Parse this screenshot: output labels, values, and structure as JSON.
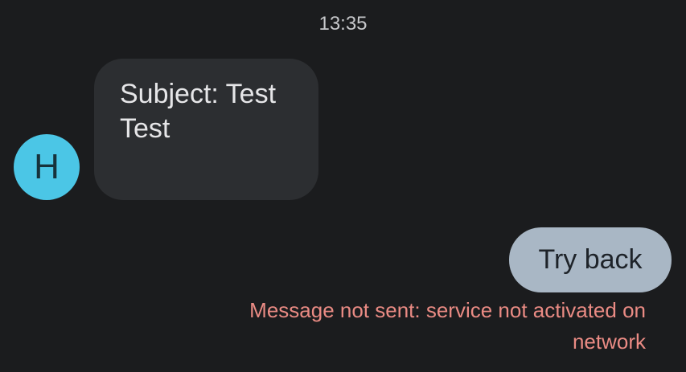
{
  "conversation": {
    "timestamp": "13:35",
    "incoming": {
      "avatar_letter": "H",
      "subject": "Subject: Test",
      "body": "Test"
    },
    "outgoing": {
      "text": "Try back",
      "error": "Message not sent: service not activated on network"
    }
  },
  "colors": {
    "background": "#1b1c1e",
    "avatar": "#4bc6e6",
    "incoming_bubble": "#2c2e31",
    "outgoing_bubble": "#a9b7c5",
    "error_text": "#ea8b84"
  }
}
